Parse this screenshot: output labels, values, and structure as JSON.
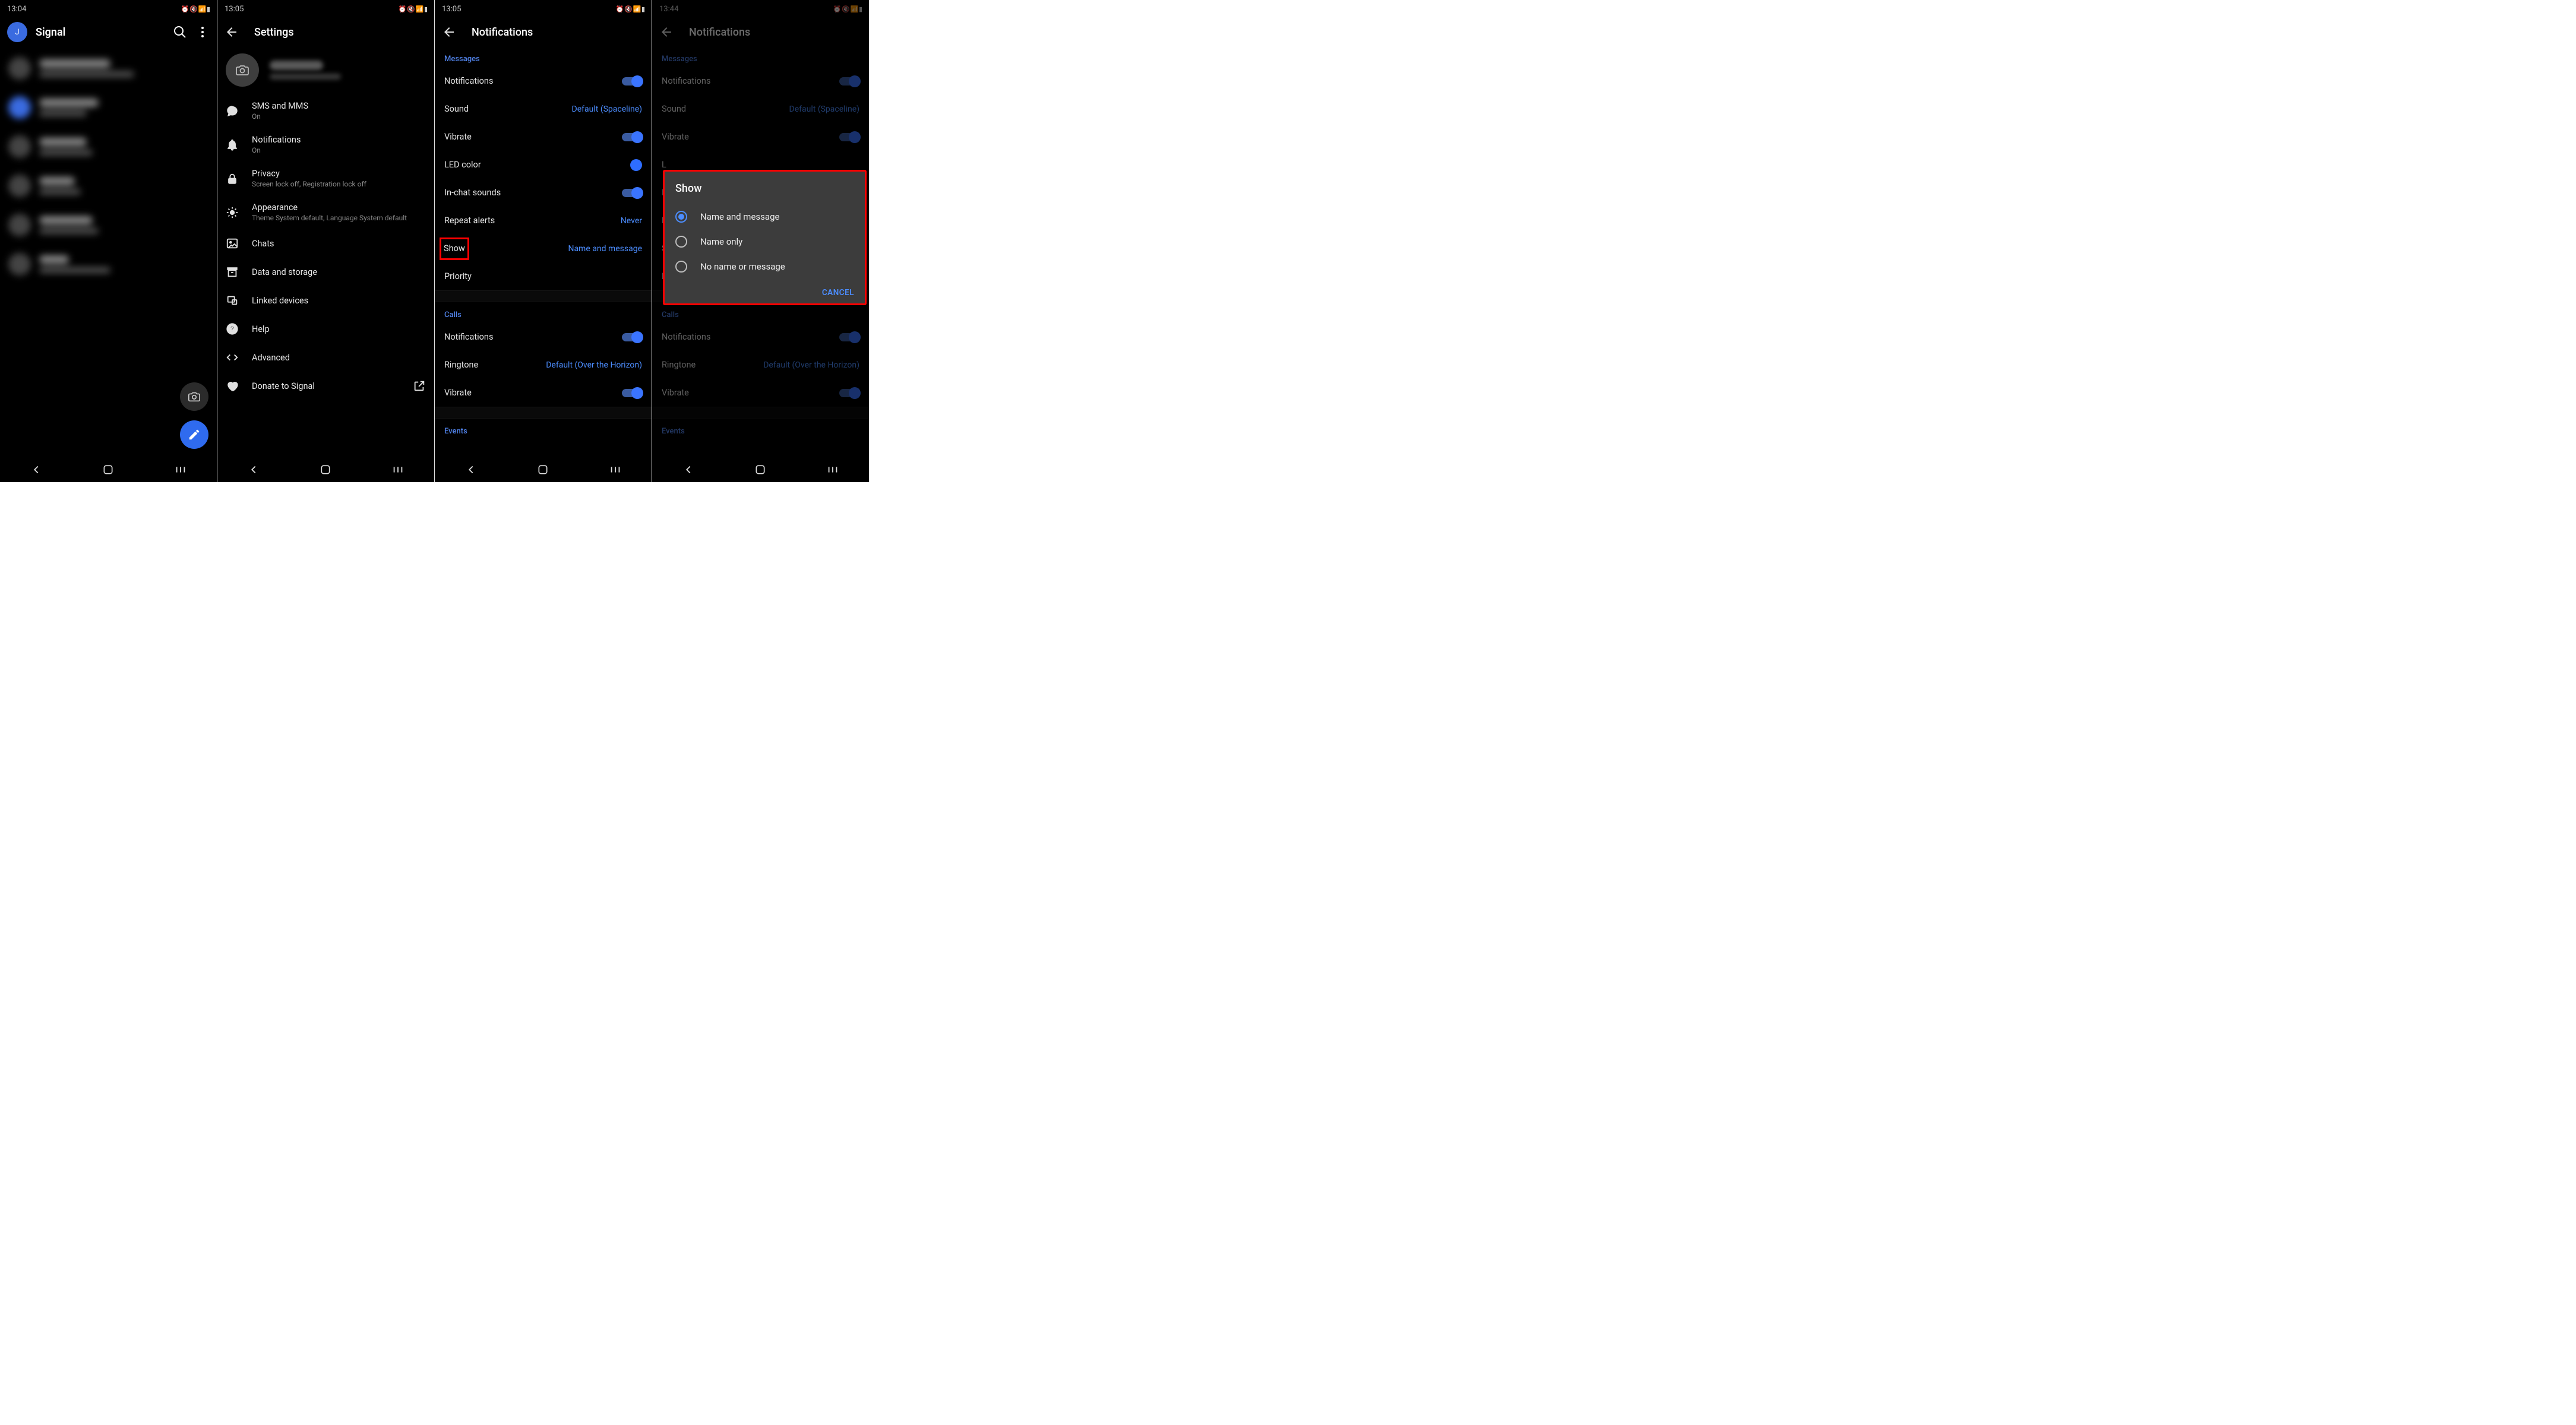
{
  "screen1": {
    "time": "13:04",
    "app_title": "Signal",
    "avatar_letter": "J"
  },
  "screen2": {
    "time": "13:05",
    "title": "Settings",
    "items": {
      "sms": {
        "label": "SMS and MMS",
        "sub": "On"
      },
      "notifications": {
        "label": "Notifications",
        "sub": "On"
      },
      "privacy": {
        "label": "Privacy",
        "sub": "Screen lock off, Registration lock off"
      },
      "appearance": {
        "label": "Appearance",
        "sub": "Theme System default, Language System default"
      },
      "chats": {
        "label": "Chats"
      },
      "data": {
        "label": "Data and storage"
      },
      "linked": {
        "label": "Linked devices"
      },
      "help": {
        "label": "Help"
      },
      "advanced": {
        "label": "Advanced"
      },
      "donate": {
        "label": "Donate to Signal"
      }
    }
  },
  "screen3": {
    "time": "13:05",
    "title": "Notifications",
    "messages_header": "Messages",
    "calls_header": "Calls",
    "events_header": "Events",
    "rows": {
      "notifications": "Notifications",
      "sound": "Sound",
      "sound_value": "Default (Spaceline)",
      "vibrate": "Vibrate",
      "led": "LED color",
      "inchat": "In-chat sounds",
      "repeat": "Repeat alerts",
      "repeat_value": "Never",
      "show": "Show",
      "show_value": "Name and message",
      "priority": "Priority",
      "call_notifications": "Notifications",
      "ringtone": "Ringtone",
      "ringtone_value": "Default (Over the Horizon)",
      "call_vibrate": "Vibrate"
    }
  },
  "screen4": {
    "time": "13:44",
    "title": "Notifications",
    "dialog": {
      "title": "Show",
      "options": [
        "Name and message",
        "Name only",
        "No name or message"
      ],
      "cancel": "CANCEL"
    }
  }
}
